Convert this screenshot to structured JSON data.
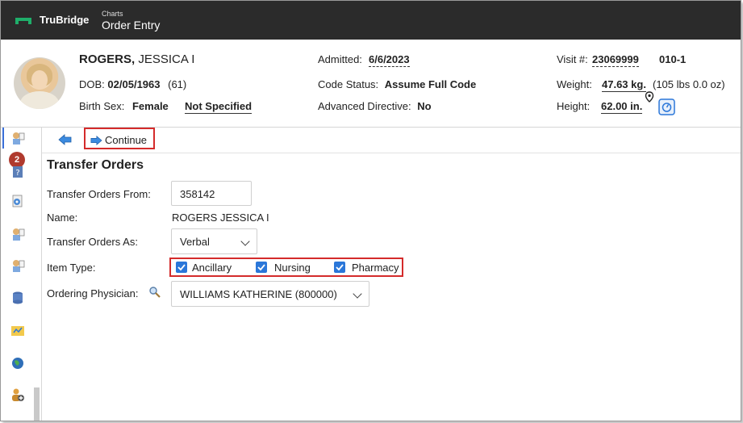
{
  "header": {
    "brand": "TruBridge",
    "section": "Charts",
    "page": "Order Entry"
  },
  "patient": {
    "last_name": "ROGERS,",
    "first_name": "JESSICA I",
    "dob_label": "DOB:",
    "dob": "02/05/1963",
    "age": "(61)",
    "sex_label": "Birth Sex:",
    "sex": "Female",
    "gender_identity": "Not Specified",
    "admitted_label": "Admitted:",
    "admitted": "6/6/2023",
    "code_status_label": "Code Status:",
    "code_status": "Assume Full Code",
    "adv_directive_label": "Advanced Directive:",
    "adv_directive": "No",
    "visit_label": "Visit #:",
    "visit": "23069999",
    "room": "010-1",
    "weight_label": "Weight:",
    "weight": "47.63 kg.",
    "weight_alt": "(105 lbs 0.0 oz)",
    "height_label": "Height:",
    "height": "62.00 in."
  },
  "nav": {
    "badge_count": "2"
  },
  "toolbar": {
    "continue_label": "Continue"
  },
  "form": {
    "title": "Transfer Orders",
    "from_label": "Transfer Orders From:",
    "from_value": "358142",
    "name_label": "Name:",
    "name_value": "ROGERS JESSICA I",
    "as_label": "Transfer Orders As:",
    "as_value": "Verbal",
    "item_type_label": "Item Type:",
    "item_types": [
      {
        "label": "Ancillary",
        "checked": true
      },
      {
        "label": "Nursing",
        "checked": true
      },
      {
        "label": "Pharmacy",
        "checked": true
      }
    ],
    "physician_label": "Ordering Physician:",
    "physician_value": "WILLIAMS KATHERINE (800000)"
  },
  "colors": {
    "topbar": "#2b2b2b",
    "accent": "#2b77d9",
    "highlight": "#d42b2b",
    "brand_green": "#1fae6a"
  }
}
